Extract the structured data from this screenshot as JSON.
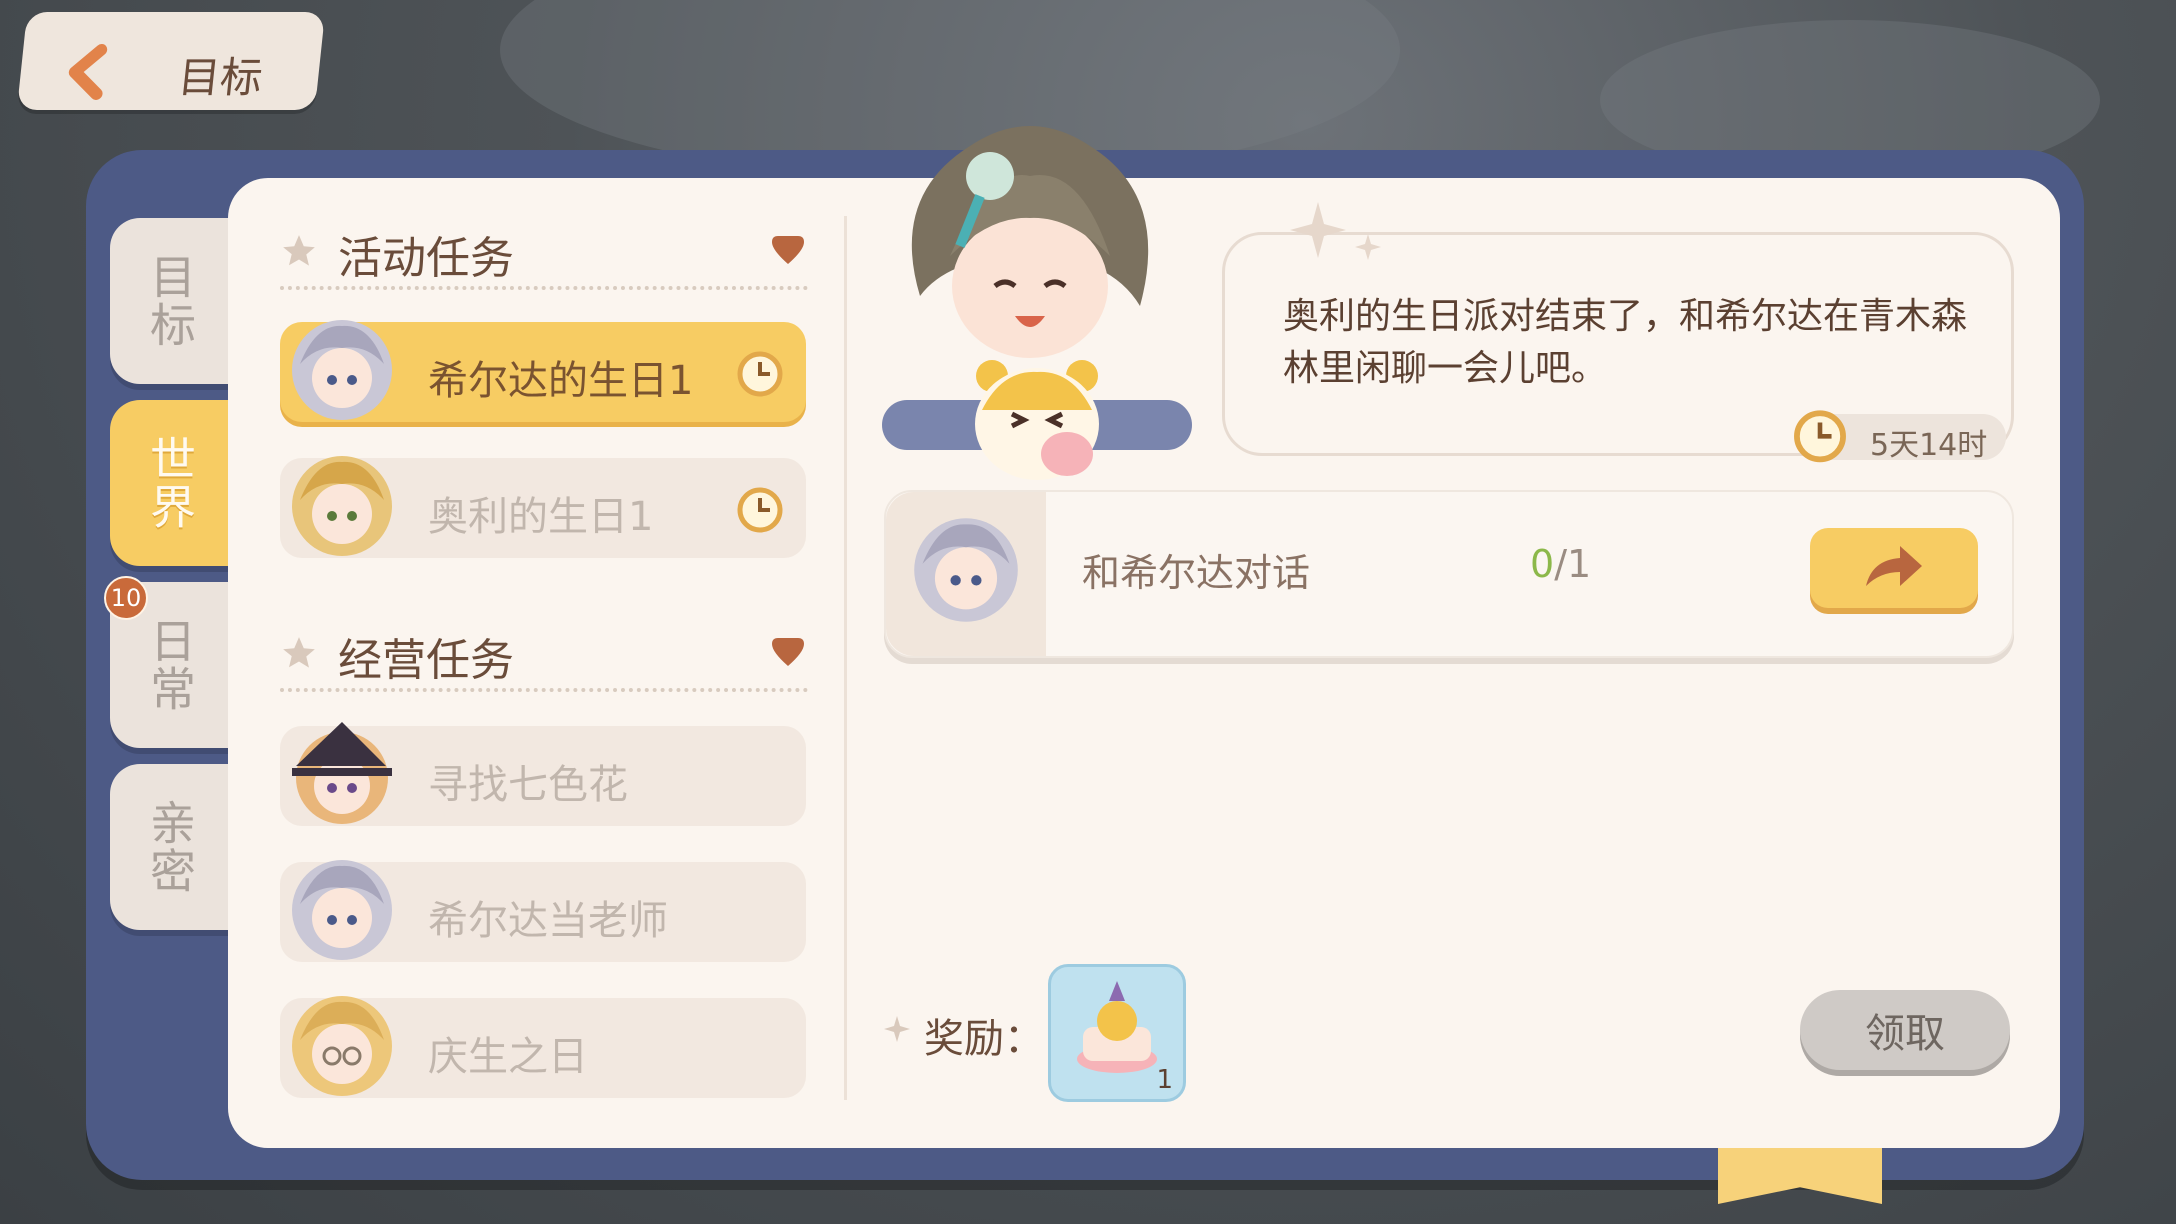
{
  "header": {
    "back_label": "目标"
  },
  "side_tabs": [
    {
      "label": "目标",
      "active": false
    },
    {
      "label": "世界",
      "active": true
    },
    {
      "label": "日常",
      "active": false,
      "badge": "10"
    },
    {
      "label": "亲密",
      "active": false
    }
  ],
  "sections": [
    {
      "title": "活动任务",
      "items": [
        {
          "label": "希尔达的生日1",
          "selected": true,
          "timed": true
        },
        {
          "label": "奥利的生日1",
          "selected": false,
          "timed": true
        }
      ]
    },
    {
      "title": "经营任务",
      "items": [
        {
          "label": "寻找七色花",
          "selected": false
        },
        {
          "label": "希尔达当老师",
          "selected": false
        },
        {
          "label": "庆生之日",
          "selected": false
        }
      ]
    }
  ],
  "detail": {
    "dialogue": "奥利的生日派对结束了，和希尔达在青木森林里闲聊一会儿吧。",
    "time_left": "5天14时",
    "objective": {
      "text": "和希尔达对话",
      "current": "0",
      "total": "/1"
    },
    "reward_label": "奖励：",
    "reward_count": "1",
    "claim_label": "领取"
  },
  "colors": {
    "frame": "#4d5a86",
    "accent_yellow": "#f7cc63",
    "text_brown": "#6a4c3a",
    "progress_green": "#8cb84a"
  }
}
